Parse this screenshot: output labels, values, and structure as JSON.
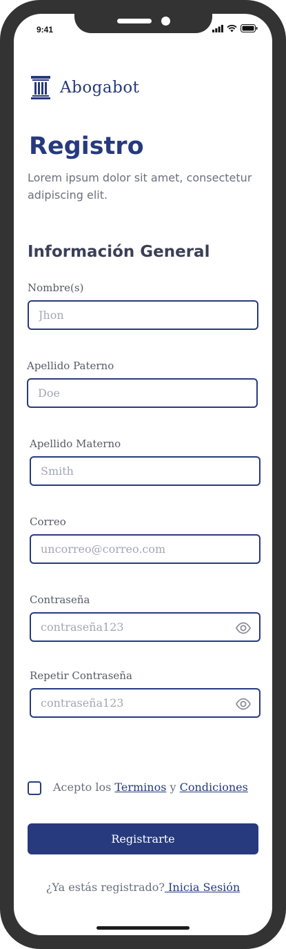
{
  "status_bar": {
    "time": "9:41"
  },
  "brand": {
    "name": "Abogabot"
  },
  "header": {
    "title": "Registro",
    "subtitle": "Lorem ipsum dolor sit amet, consectetur adipiscing elit."
  },
  "form": {
    "section_title": "Información General",
    "fields": [
      {
        "label": "Nombre(s)",
        "placeholder": "Jhon"
      },
      {
        "label": "Apellido Paterno",
        "placeholder": "Doe"
      },
      {
        "label": "Apellido Materno",
        "placeholder": "Smith"
      },
      {
        "label": "Correo",
        "placeholder": "uncorreo@correo.com"
      },
      {
        "label": "Contraseña",
        "placeholder": "contraseña123"
      },
      {
        "label": "Repetir Contraseña",
        "placeholder": "contraseña123"
      }
    ],
    "terms": {
      "prefix": "Acepto los ",
      "terms_link": "Terminos",
      "connector": " y ",
      "conditions_link": "Condiciones",
      "checked": false
    },
    "submit_label": "Registrarte",
    "login_prompt": "¿Ya  estás registrado?",
    "login_link": " Inicia Sesión"
  },
  "colors": {
    "primary": "#263a7d",
    "frame": "#333333",
    "text_muted": "#6c6f7e"
  },
  "icons": [
    "pillar-logo-icon",
    "signal-icon",
    "wifi-icon",
    "battery-icon",
    "eye-icon"
  ]
}
